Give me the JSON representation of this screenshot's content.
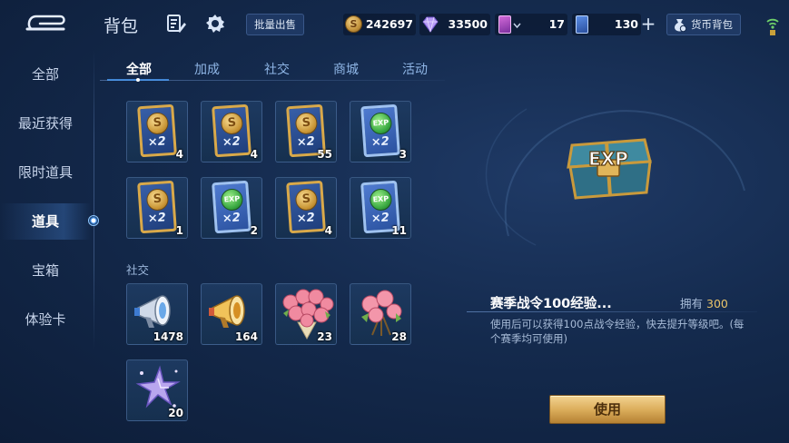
{
  "header": {
    "title": "背包",
    "bulk_sell_label": "批量出售",
    "wallet_label": "货币背包"
  },
  "currencies": {
    "gold": "242697",
    "diamond": "33500",
    "coupon": "17",
    "ticket": "130"
  },
  "sidebar": {
    "items": [
      {
        "label": "全部"
      },
      {
        "label": "最近获得"
      },
      {
        "label": "限时道具"
      },
      {
        "label": "道具"
      },
      {
        "label": "宝箱"
      },
      {
        "label": "体验卡"
      }
    ],
    "active_index": 3
  },
  "tabs": {
    "items": [
      {
        "label": "全部"
      },
      {
        "label": "加成"
      },
      {
        "label": "社交"
      },
      {
        "label": "商城"
      },
      {
        "label": "活动"
      }
    ],
    "active_index": 0
  },
  "boost_items": [
    {
      "kind": "gold-card",
      "emblem": "S",
      "mult": "×2",
      "count": "4"
    },
    {
      "kind": "gold-card",
      "emblem": "S",
      "mult": "×2",
      "count": "4"
    },
    {
      "kind": "gold-card",
      "emblem": "S",
      "mult": "×2",
      "count": "55"
    },
    {
      "kind": "exp-card",
      "emblem": "EXP",
      "mult": "×2",
      "count": "3"
    },
    {
      "kind": "gold-card",
      "emblem": "S",
      "mult": "×2",
      "count": "1"
    },
    {
      "kind": "exp-card",
      "emblem": "EXP",
      "mult": "×2",
      "count": "2"
    },
    {
      "kind": "gold-card",
      "emblem": "S",
      "mult": "×2",
      "count": "4"
    },
    {
      "kind": "exp-card",
      "emblem": "EXP",
      "mult": "×2",
      "count": "11"
    }
  ],
  "social": {
    "label": "社交",
    "items": [
      {
        "kind": "megaphone-silver",
        "count": "1478"
      },
      {
        "kind": "megaphone-gold",
        "count": "164"
      },
      {
        "kind": "rose-bouquet",
        "count": "23"
      },
      {
        "kind": "rose-small",
        "count": "28"
      },
      {
        "kind": "star-firework",
        "count": "20"
      }
    ]
  },
  "detail": {
    "name": "赛季战令100经验...",
    "own_label": "拥有",
    "own_count": "300",
    "description": "使用后可以获得100点战令经验，快去提升等级吧。(每个赛季均可使用)",
    "use_label": "使用",
    "art_text": "EXP"
  },
  "colors": {
    "accent_gold": "#e9c46a",
    "tab_active": "#ffffff",
    "tab_inactive": "#8fb6e6"
  }
}
